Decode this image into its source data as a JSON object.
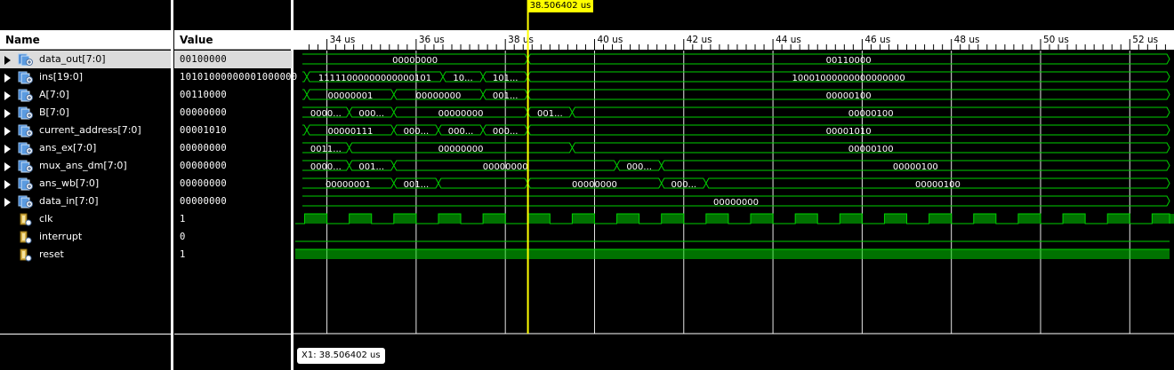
{
  "columns": {
    "name": "Name",
    "value": "Value"
  },
  "cursor": {
    "label": "38.506402 us",
    "readout": "X1: 38.506402 us",
    "time_us": 38.506402
  },
  "colors": {
    "wave": "#00d000",
    "cursor": "#ffff00",
    "grid": "#ffffff",
    "bg": "#000000"
  },
  "timeline": {
    "start_us": 33.45,
    "ticks": [
      "34 us",
      "36 us",
      "38 us",
      "40 us",
      "42 us",
      "44 us",
      "46 us",
      "48 us",
      "50 us",
      "52 us"
    ],
    "tick_values_us": [
      34,
      36,
      38,
      40,
      42,
      44,
      46,
      48,
      50,
      52
    ]
  },
  "signals": [
    {
      "name": "data_out[7:0]",
      "value": "00100000",
      "type": "bus",
      "icon": "bus-output-icon",
      "segments": [
        {
          "s": 33.45,
          "v": "00000000"
        },
        {
          "s": 38.5,
          "v": "00110000"
        }
      ]
    },
    {
      "name": "ins[19:0]",
      "value": "10101000000001000000",
      "type": "bus",
      "icon": "bus-input-icon",
      "segments": [
        {
          "s": 33.45,
          "v": ""
        },
        {
          "s": 33.55,
          "v": "11111000000000000101"
        },
        {
          "s": 36.6,
          "v": "10111..."
        },
        {
          "s": 37.5,
          "v": "10101..."
        },
        {
          "s": 38.5,
          "v": "10001000000000000000"
        }
      ]
    },
    {
      "name": "A[7:0]",
      "value": "00110000",
      "type": "bus",
      "icon": "bus-input-icon",
      "segments": [
        {
          "s": 33.45,
          "v": ""
        },
        {
          "s": 33.55,
          "v": "00000001"
        },
        {
          "s": 35.5,
          "v": "00000000"
        },
        {
          "s": 37.5,
          "v": "00110..."
        },
        {
          "s": 38.5,
          "v": "00000100"
        }
      ]
    },
    {
      "name": "B[7:0]",
      "value": "00000000",
      "type": "bus",
      "icon": "bus-input-icon",
      "segments": [
        {
          "s": 33.45,
          "v": "00000..."
        },
        {
          "s": 34.5,
          "v": "00000..."
        },
        {
          "s": 35.5,
          "v": "00000000"
        },
        {
          "s": 38.5,
          "v": "00110..."
        },
        {
          "s": 39.5,
          "v": "00000100"
        }
      ]
    },
    {
      "name": "current_address[7:0]",
      "value": "00001010",
      "type": "bus",
      "icon": "bus-input-icon",
      "segments": [
        {
          "s": 33.45,
          "v": ""
        },
        {
          "s": 33.55,
          "v": "00000111"
        },
        {
          "s": 35.5,
          "v": "00001..."
        },
        {
          "s": 36.5,
          "v": "00001..."
        },
        {
          "s": 37.5,
          "v": "00000001..."
        },
        {
          "s": 38.5,
          "v": "00001010"
        }
      ]
    },
    {
      "name": "ans_ex[7:0]",
      "value": "00000000",
      "type": "bus",
      "icon": "bus-input-icon",
      "segments": [
        {
          "s": 33.45,
          "v": "00110..."
        },
        {
          "s": 34.5,
          "v": "00000000"
        },
        {
          "s": 39.5,
          "v": "00000100"
        }
      ]
    },
    {
      "name": "mux_ans_dm[7:0]",
      "value": "00000000",
      "type": "bus",
      "icon": "bus-input-icon",
      "segments": [
        {
          "s": 33.45,
          "v": "00000..."
        },
        {
          "s": 34.5,
          "v": "00110..."
        },
        {
          "s": 35.5,
          "v": "00000000"
        },
        {
          "s": 40.5,
          "v": "00010..."
        },
        {
          "s": 41.5,
          "v": "00000100"
        }
      ]
    },
    {
      "name": "ans_wb[7:0]",
      "value": "00000000",
      "type": "bus",
      "icon": "bus-input-icon",
      "segments": [
        {
          "s": 33.45,
          "v": "00000001"
        },
        {
          "s": 35.5,
          "v": "00110..."
        },
        {
          "s": 36.5,
          "v": ""
        },
        {
          "s": 38.5,
          "v": "00000000"
        },
        {
          "s": 41.5,
          "v": "00010..."
        },
        {
          "s": 42.5,
          "v": "00000100"
        }
      ]
    },
    {
      "name": "data_in[7:0]",
      "value": "00000000",
      "type": "bus",
      "icon": "bus-input-icon",
      "segments": [
        {
          "s": 33.45,
          "v": "00000000"
        }
      ]
    },
    {
      "name": "clk",
      "value": "1",
      "type": "clock",
      "icon": "bit-signal-icon",
      "clock": {
        "first_rise_us": 33.5,
        "period_us": 1.0,
        "high_us": 0.5
      }
    },
    {
      "name": "interrupt",
      "value": "0",
      "type": "low",
      "icon": "bit-signal-icon"
    },
    {
      "name": "reset",
      "value": "1",
      "type": "high",
      "icon": "bit-signal-icon"
    }
  ]
}
